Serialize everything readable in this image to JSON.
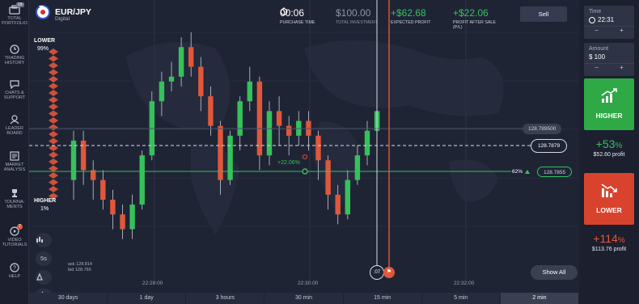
{
  "sidebar": {
    "items": [
      {
        "label": "TOTAL PORTFOLIO",
        "icon": "portfolio-icon",
        "badge": "29"
      },
      {
        "label": "TRADING HISTORY",
        "icon": "history-icon"
      },
      {
        "label": "CHATS & SUPPORT",
        "icon": "chat-icon"
      },
      {
        "label": "LEADER BOARD",
        "icon": "leaderboard-icon"
      },
      {
        "label": "MARKET ANALYSIS",
        "icon": "market-analysis-icon"
      },
      {
        "label": "TOURNA-MENTS",
        "icon": "trophy-icon"
      },
      {
        "label": "VIDEO TUTORIALS",
        "icon": "video-icon",
        "badge": "7"
      },
      {
        "label": "HELP",
        "icon": "help-icon"
      }
    ]
  },
  "asset": {
    "name": "EUR/JPY",
    "type": "Digital"
  },
  "stats": {
    "purchase_time": {
      "value": "00:06",
      "label": "PURCHASE TIME"
    },
    "total_investment": {
      "value": "$100.00",
      "label": "TOTAL INVESTMENT"
    },
    "expected_profit": {
      "value": "+$62.68",
      "label": "EXPECTED PROFIT"
    },
    "profit_after_sale": {
      "value": "+$22.06",
      "label": "PROFIT AFTER SALE (P/L)"
    }
  },
  "sell_label": "Sell",
  "probability": {
    "lower_label": "LOWER",
    "lower_value": "99%",
    "higher_label": "HIGHER",
    "higher_value": "1%"
  },
  "price_tags": {
    "gray": "128.789500",
    "current": "128.7879",
    "strike": "128.7855",
    "strike_pct": "62%"
  },
  "position_profit": "+22.06%",
  "ask_bid": {
    "ask": "ask 128.814",
    "bid": "bid 128.765"
  },
  "tools": {
    "interval": "5s"
  },
  "time_axis": [
    "22:28:00",
    "22:30:00",
    "22:32:00"
  ],
  "timer": ":07",
  "show_all_label": "Show All",
  "periods": [
    "30 days",
    "1 day",
    "3 hours",
    "30 min",
    "15 min",
    "5 min",
    "2 min"
  ],
  "active_period": "2 min",
  "right_panel": {
    "time_label": "Time",
    "time_value": "22:31",
    "amount_label": "Amount",
    "amount_value": "$ 100",
    "minus": "−",
    "plus": "+",
    "higher_label": "HIGHER",
    "higher_pct": "+53",
    "higher_pct_sign": "%",
    "higher_profit": "$52.60 profit",
    "lower_label": "LOWER",
    "lower_pct": "+114",
    "lower_pct_sign": "%",
    "lower_profit": "$113.76 profit"
  },
  "colors": {
    "green": "#2fa846",
    "red": "#d9432d",
    "bg": "#1f2435",
    "panel": "#1b1f2e"
  },
  "chart_data": {
    "type": "candlestick",
    "note_visible": false,
    "candles": [
      {
        "o": 128.776,
        "c": 128.784,
        "h": 128.786,
        "l": 128.772
      },
      {
        "o": 128.784,
        "c": 128.778,
        "h": 128.786,
        "l": 128.775
      },
      {
        "o": 128.778,
        "c": 128.776,
        "h": 128.78,
        "l": 128.772
      },
      {
        "o": 128.776,
        "c": 128.772,
        "h": 128.778,
        "l": 128.77
      },
      {
        "o": 128.772,
        "c": 128.769,
        "h": 128.774,
        "l": 128.766
      },
      {
        "o": 128.769,
        "c": 128.766,
        "h": 128.771,
        "l": 128.764
      },
      {
        "o": 128.766,
        "c": 128.771,
        "h": 128.773,
        "l": 128.764
      },
      {
        "o": 128.771,
        "c": 128.781,
        "h": 128.782,
        "l": 128.77
      },
      {
        "o": 128.781,
        "c": 128.792,
        "h": 128.794,
        "l": 128.78
      },
      {
        "o": 128.792,
        "c": 128.796,
        "h": 128.798,
        "l": 128.789
      },
      {
        "o": 128.796,
        "c": 128.797,
        "h": 128.8,
        "l": 128.794
      },
      {
        "o": 128.797,
        "c": 128.803,
        "h": 128.805,
        "l": 128.795
      },
      {
        "o": 128.803,
        "c": 128.799,
        "h": 128.806,
        "l": 128.797
      },
      {
        "o": 128.799,
        "c": 128.793,
        "h": 128.801,
        "l": 128.79
      },
      {
        "o": 128.793,
        "c": 128.787,
        "h": 128.795,
        "l": 128.785
      },
      {
        "o": 128.787,
        "c": 128.776,
        "h": 128.788,
        "l": 128.773
      },
      {
        "o": 128.776,
        "c": 128.785,
        "h": 128.786,
        "l": 128.775
      },
      {
        "o": 128.785,
        "c": 128.792,
        "h": 128.793,
        "l": 128.782
      },
      {
        "o": 128.792,
        "c": 128.796,
        "h": 128.799,
        "l": 128.79
      },
      {
        "o": 128.796,
        "c": 128.781,
        "h": 128.797,
        "l": 128.778
      },
      {
        "o": 128.781,
        "c": 128.79,
        "h": 128.792,
        "l": 128.779
      },
      {
        "o": 128.79,
        "c": 128.787,
        "h": 128.793,
        "l": 128.783
      },
      {
        "o": 128.787,
        "c": 128.785,
        "h": 128.789,
        "l": 128.781
      },
      {
        "o": 128.785,
        "c": 128.788,
        "h": 128.79,
        "l": 128.783
      },
      {
        "o": 128.788,
        "c": 128.785,
        "h": 128.79,
        "l": 128.782
      },
      {
        "o": 128.785,
        "c": 128.78,
        "h": 128.786,
        "l": 128.776
      },
      {
        "o": 128.78,
        "c": 128.773,
        "h": 128.781,
        "l": 128.77
      },
      {
        "o": 128.773,
        "c": 128.769,
        "h": 128.775,
        "l": 128.767
      },
      {
        "o": 128.769,
        "c": 128.776,
        "h": 128.778,
        "l": 128.768
      },
      {
        "o": 128.776,
        "c": 128.781,
        "h": 128.783,
        "l": 128.775
      },
      {
        "o": 128.781,
        "c": 128.786,
        "h": 128.788,
        "l": 128.779
      },
      {
        "o": 128.786,
        "c": 128.79,
        "h": 128.792,
        "l": 128.785
      }
    ]
  }
}
